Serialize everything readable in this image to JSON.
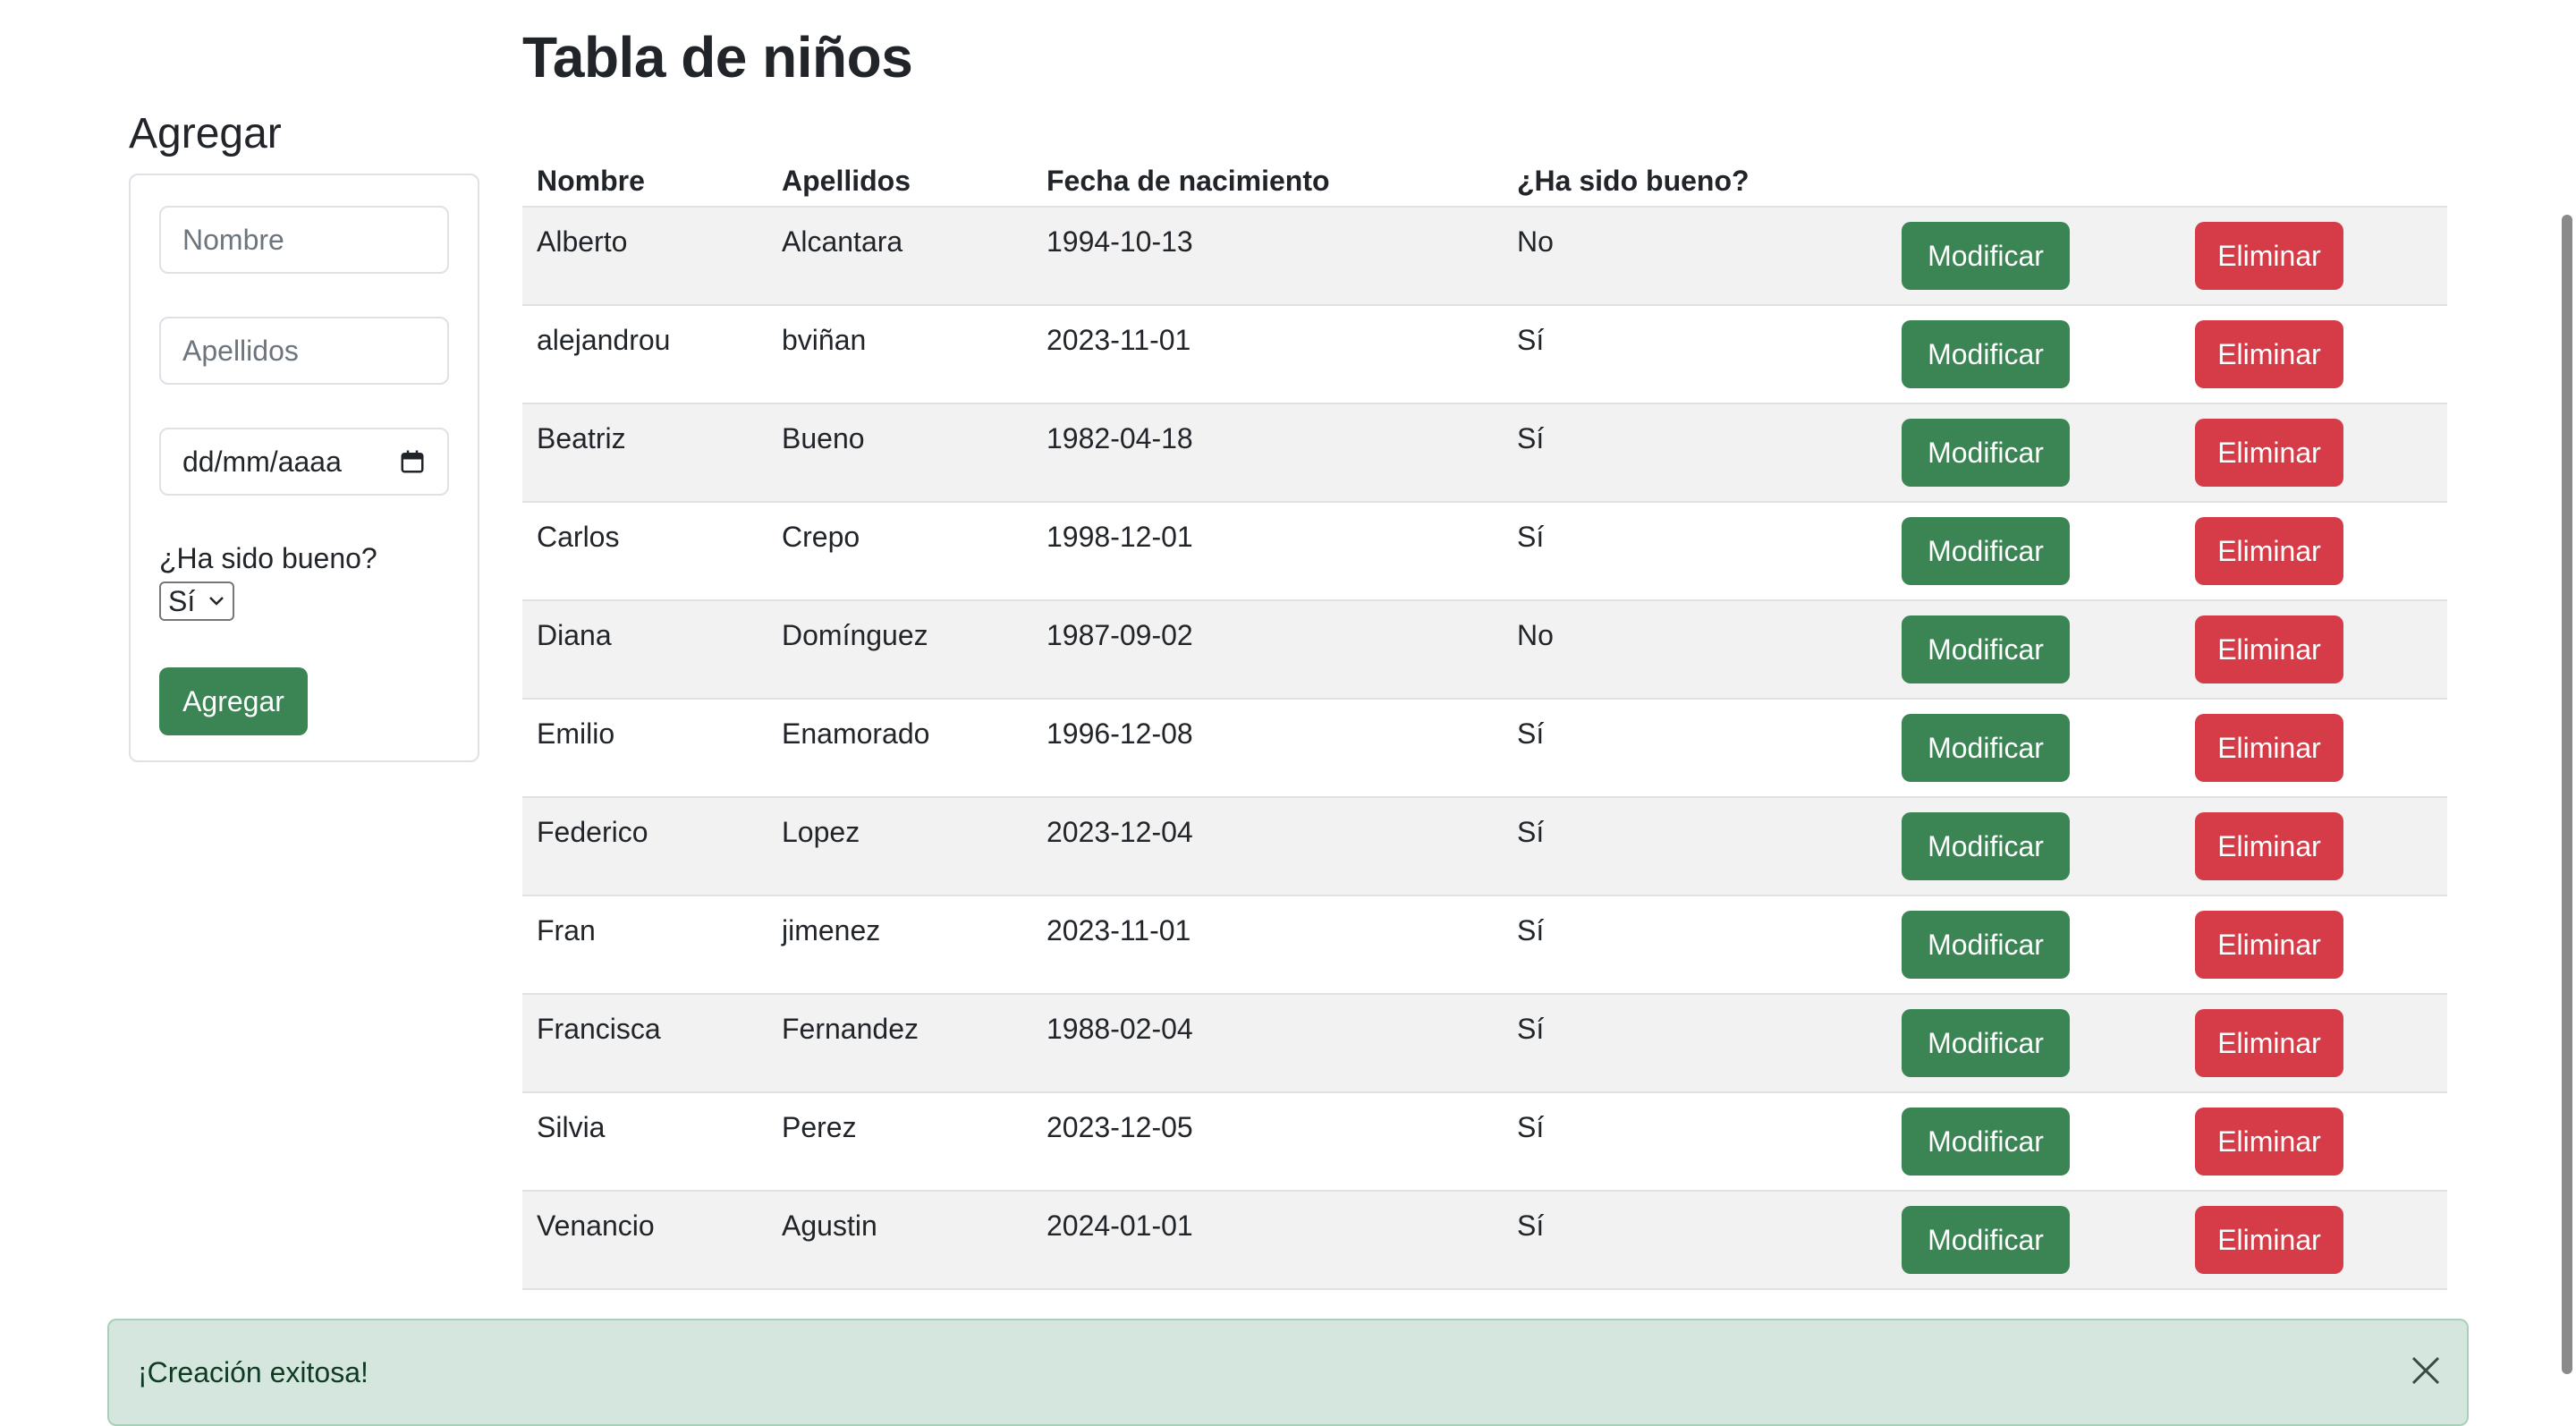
{
  "page_title": "Tabla de niños",
  "add_form": {
    "title": "Agregar",
    "nombre_placeholder": "Nombre",
    "apellidos_placeholder": "Apellidos",
    "date_placeholder": "dd/mm/aaaa",
    "good_label": "¿Ha sido bueno?",
    "good_selected": "Sí",
    "add_button": "Agregar",
    "calendar_icon": "calendar-icon"
  },
  "table": {
    "headers": [
      "Nombre",
      "Apellidos",
      "Fecha de nacimiento",
      "¿Ha sido bueno?"
    ],
    "modify_label": "Modificar",
    "delete_label": "Eliminar",
    "rows": [
      {
        "nombre": "Alberto",
        "apellidos": "Alcantara",
        "fecha": "1994-10-13",
        "bueno": "No"
      },
      {
        "nombre": "alejandrou",
        "apellidos": "bviñan",
        "fecha": "2023-11-01",
        "bueno": "Sí"
      },
      {
        "nombre": "Beatriz",
        "apellidos": "Bueno",
        "fecha": "1982-04-18",
        "bueno": "Sí"
      },
      {
        "nombre": "Carlos",
        "apellidos": "Crepo",
        "fecha": "1998-12-01",
        "bueno": "Sí"
      },
      {
        "nombre": "Diana",
        "apellidos": "Domínguez",
        "fecha": "1987-09-02",
        "bueno": "No"
      },
      {
        "nombre": "Emilio",
        "apellidos": "Enamorado",
        "fecha": "1996-12-08",
        "bueno": "Sí"
      },
      {
        "nombre": "Federico",
        "apellidos": "Lopez",
        "fecha": "2023-12-04",
        "bueno": "Sí"
      },
      {
        "nombre": "Fran",
        "apellidos": "jimenez",
        "fecha": "2023-11-01",
        "bueno": "Sí"
      },
      {
        "nombre": "Francisca",
        "apellidos": "Fernandez",
        "fecha": "1988-02-04",
        "bueno": "Sí"
      },
      {
        "nombre": "Silvia",
        "apellidos": "Perez",
        "fecha": "2023-12-05",
        "bueno": "Sí"
      },
      {
        "nombre": "Venancio",
        "apellidos": "Agustin",
        "fecha": "2024-01-01",
        "bueno": "Sí"
      }
    ]
  },
  "alert": {
    "message": "¡Creación exitosa!",
    "close_icon": "close-icon"
  },
  "colors": {
    "success_button": "#3b8454",
    "danger_button": "#d63c48",
    "alert_background": "#d4e6de",
    "row_stripe": "#f2f2f2"
  }
}
